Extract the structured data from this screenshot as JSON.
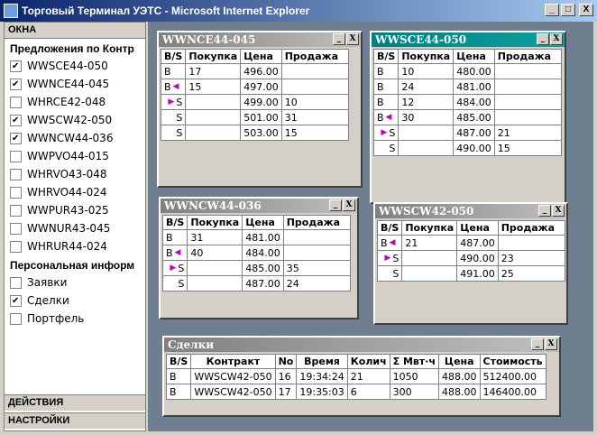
{
  "window": {
    "title": "Торговый Терминал УЭТС - Microsoft Internet Explorer",
    "min": "_",
    "max": "□",
    "close": "X"
  },
  "sidebar": {
    "header": "ОКНА",
    "offers_title": "Предложения по Контр",
    "contracts": [
      {
        "label": "WWSCE44-050",
        "checked": true
      },
      {
        "label": "WWNCE44-045",
        "checked": true
      },
      {
        "label": "WHRCE42-048",
        "checked": false
      },
      {
        "label": "WWSCW42-050",
        "checked": true
      },
      {
        "label": "WWNCW44-036",
        "checked": true
      },
      {
        "label": "WWPVO44-015",
        "checked": false
      },
      {
        "label": "WHRVO43-048",
        "checked": false
      },
      {
        "label": "WHRVO44-024",
        "checked": false
      },
      {
        "label": "WWPUR43-025",
        "checked": false
      },
      {
        "label": "WWNUR43-045",
        "checked": false
      },
      {
        "label": "WHRUR44-024",
        "checked": false
      }
    ],
    "personal_title": "Персональная информ",
    "personal": [
      {
        "label": "Заявки",
        "checked": false
      },
      {
        "label": "Сделки",
        "checked": true
      },
      {
        "label": "Портфель",
        "checked": false
      }
    ],
    "actions": "ДЕЙСТВИЯ",
    "settings": "НАСТРОЙКИ"
  },
  "cols": {
    "bs": "B/S",
    "buy": "Покупка",
    "price": "Цена",
    "sell": "Продажа"
  },
  "panels": [
    {
      "title": "WWNCE44-045",
      "active": false,
      "rows": [
        {
          "bs": "B",
          "mark": "",
          "buy": "17",
          "price": "496.00",
          "sell": ""
        },
        {
          "bs": "B",
          "mark": "left",
          "buy": "15",
          "price": "497.00",
          "sell": ""
        },
        {
          "bs": "S",
          "mark": "right",
          "buy": "",
          "price": "499.00",
          "sell": "10"
        },
        {
          "bs": "S",
          "mark": "",
          "buy": "",
          "price": "501.00",
          "sell": "31"
        },
        {
          "bs": "S",
          "mark": "",
          "buy": "",
          "price": "503.00",
          "sell": "15"
        }
      ]
    },
    {
      "title": "WWSCE44-050",
      "active": true,
      "rows": [
        {
          "bs": "B",
          "mark": "",
          "buy": "10",
          "price": "480.00",
          "sell": ""
        },
        {
          "bs": "B",
          "mark": "",
          "buy": "24",
          "price": "481.00",
          "sell": ""
        },
        {
          "bs": "B",
          "mark": "",
          "buy": "12",
          "price": "484.00",
          "sell": ""
        },
        {
          "bs": "B",
          "mark": "left",
          "buy": "30",
          "price": "485.00",
          "sell": ""
        },
        {
          "bs": "S",
          "mark": "right",
          "buy": "",
          "price": "487.00",
          "sell": "21"
        },
        {
          "bs": "S",
          "mark": "",
          "buy": "",
          "price": "490.00",
          "sell": "15"
        }
      ]
    },
    {
      "title": "WWNCW44-036",
      "active": false,
      "rows": [
        {
          "bs": "B",
          "mark": "",
          "buy": "31",
          "price": "481.00",
          "sell": ""
        },
        {
          "bs": "B",
          "mark": "left",
          "buy": "40",
          "price": "484.00",
          "sell": ""
        },
        {
          "bs": "S",
          "mark": "right",
          "buy": "",
          "price": "485.00",
          "sell": "35"
        },
        {
          "bs": "S",
          "mark": "",
          "buy": "",
          "price": "487.00",
          "sell": "24"
        }
      ]
    },
    {
      "title": "WWSCW42-050",
      "active": false,
      "rows": [
        {
          "bs": "B",
          "mark": "left",
          "buy": "21",
          "price": "487.00",
          "sell": ""
        },
        {
          "bs": "S",
          "mark": "right",
          "buy": "",
          "price": "490.00",
          "sell": "23"
        },
        {
          "bs": "S",
          "mark": "",
          "buy": "",
          "price": "491.00",
          "sell": "25"
        }
      ]
    }
  ],
  "deals": {
    "title": "Сделки",
    "headers": [
      "B/S",
      "Контракт",
      "No",
      "Время",
      "Колич",
      "Σ Мвт·ч",
      "Цена",
      "Стоимость"
    ],
    "rows": [
      [
        "B",
        "WWSCW42-050",
        "16",
        "19:34:24",
        "21",
        "1050",
        "488.00",
        "512400.00"
      ],
      [
        "B",
        "WWSCW42-050",
        "17",
        "19:35:03",
        "6",
        "300",
        "488.00",
        "146400.00"
      ]
    ]
  }
}
